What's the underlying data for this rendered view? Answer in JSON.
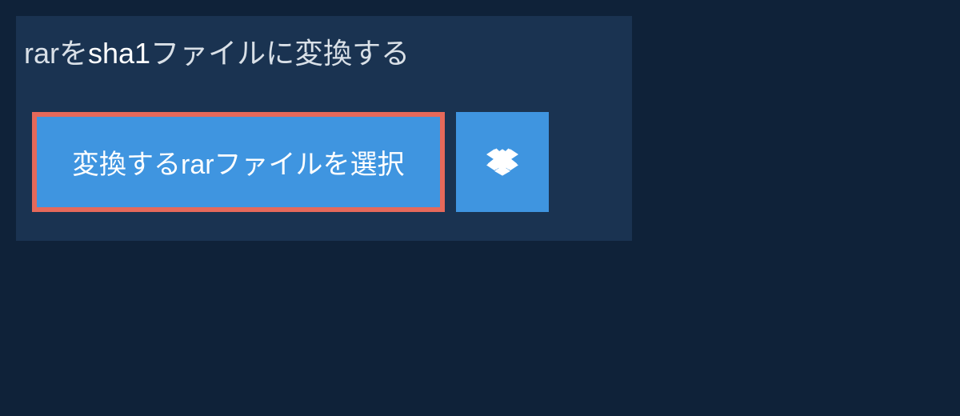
{
  "title": {
    "prefix": "rar",
    "middle": "を",
    "highlight": "sha1",
    "suffix": "ファイルに変換する"
  },
  "buttons": {
    "select_label": "変換するrarファイルを選択",
    "dropbox_label": "Dropbox"
  },
  "colors": {
    "background": "#0f2239",
    "panel": "#1a3351",
    "button": "#3f95e0",
    "button_border": "#e6695a",
    "text": "#d9e0e7"
  }
}
